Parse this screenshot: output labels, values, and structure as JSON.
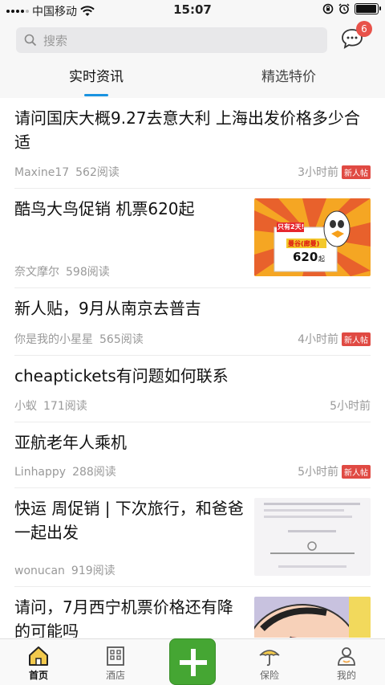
{
  "status_bar": {
    "carrier": "中国移动",
    "time": "15:07",
    "battery_level": 0.95
  },
  "search": {
    "placeholder": "搜索"
  },
  "messages": {
    "badge_count": "6"
  },
  "tabs": [
    {
      "label": "实时资讯",
      "active": true
    },
    {
      "label": "精选特价",
      "active": false
    }
  ],
  "posts": [
    {
      "title": "请问国庆大概9.27去意大利 上海出发价格多少合适",
      "author": "Maxine17",
      "reads": "562阅读",
      "time": "3小时前",
      "tag": "新人帖"
    },
    {
      "title": "酷鸟大鸟促销 机票620起",
      "author": "奈文摩尔",
      "reads": "598阅读",
      "time": "",
      "tag": "",
      "thumb": {
        "badge": "只有2天!",
        "dest": "曼谷(廊曼)",
        "price": "620",
        "unit": "起"
      }
    },
    {
      "title": "新人贴，9月从南京去普吉",
      "author": "你是我的小星星",
      "reads": "565阅读",
      "time": "4小时前",
      "tag": "新人帖"
    },
    {
      "title": "cheaptickets有问题如何联系",
      "author": "小蚁",
      "reads": "171阅读",
      "time": "5小时前",
      "tag": ""
    },
    {
      "title": "亚航老年人乘机",
      "author": "Linhappy",
      "reads": "288阅读",
      "time": "5小时前",
      "tag": "新人帖"
    },
    {
      "title": "快运 周促销 | 下次旅行，和爸爸一起出发",
      "author": "wonucan",
      "reads": "919阅读",
      "time": "",
      "tag": ""
    },
    {
      "title": "请问，7月西宁机票价格还有降的可能吗",
      "author": "",
      "reads": "",
      "time": "",
      "tag": ""
    }
  ],
  "bottom_nav": [
    {
      "label": "首页",
      "icon": "home-icon",
      "active": true
    },
    {
      "label": "酒店",
      "icon": "hotel-icon",
      "active": false
    },
    {
      "label": "",
      "icon": "plus-icon",
      "active": false
    },
    {
      "label": "保险",
      "icon": "umbrella-icon",
      "active": false
    },
    {
      "label": "我的",
      "icon": "profile-icon",
      "active": false
    }
  ],
  "colors": {
    "accent": "#1a93e0",
    "badge": "#e8524a",
    "tag": "#e04a43",
    "add_button": "#45a633"
  }
}
